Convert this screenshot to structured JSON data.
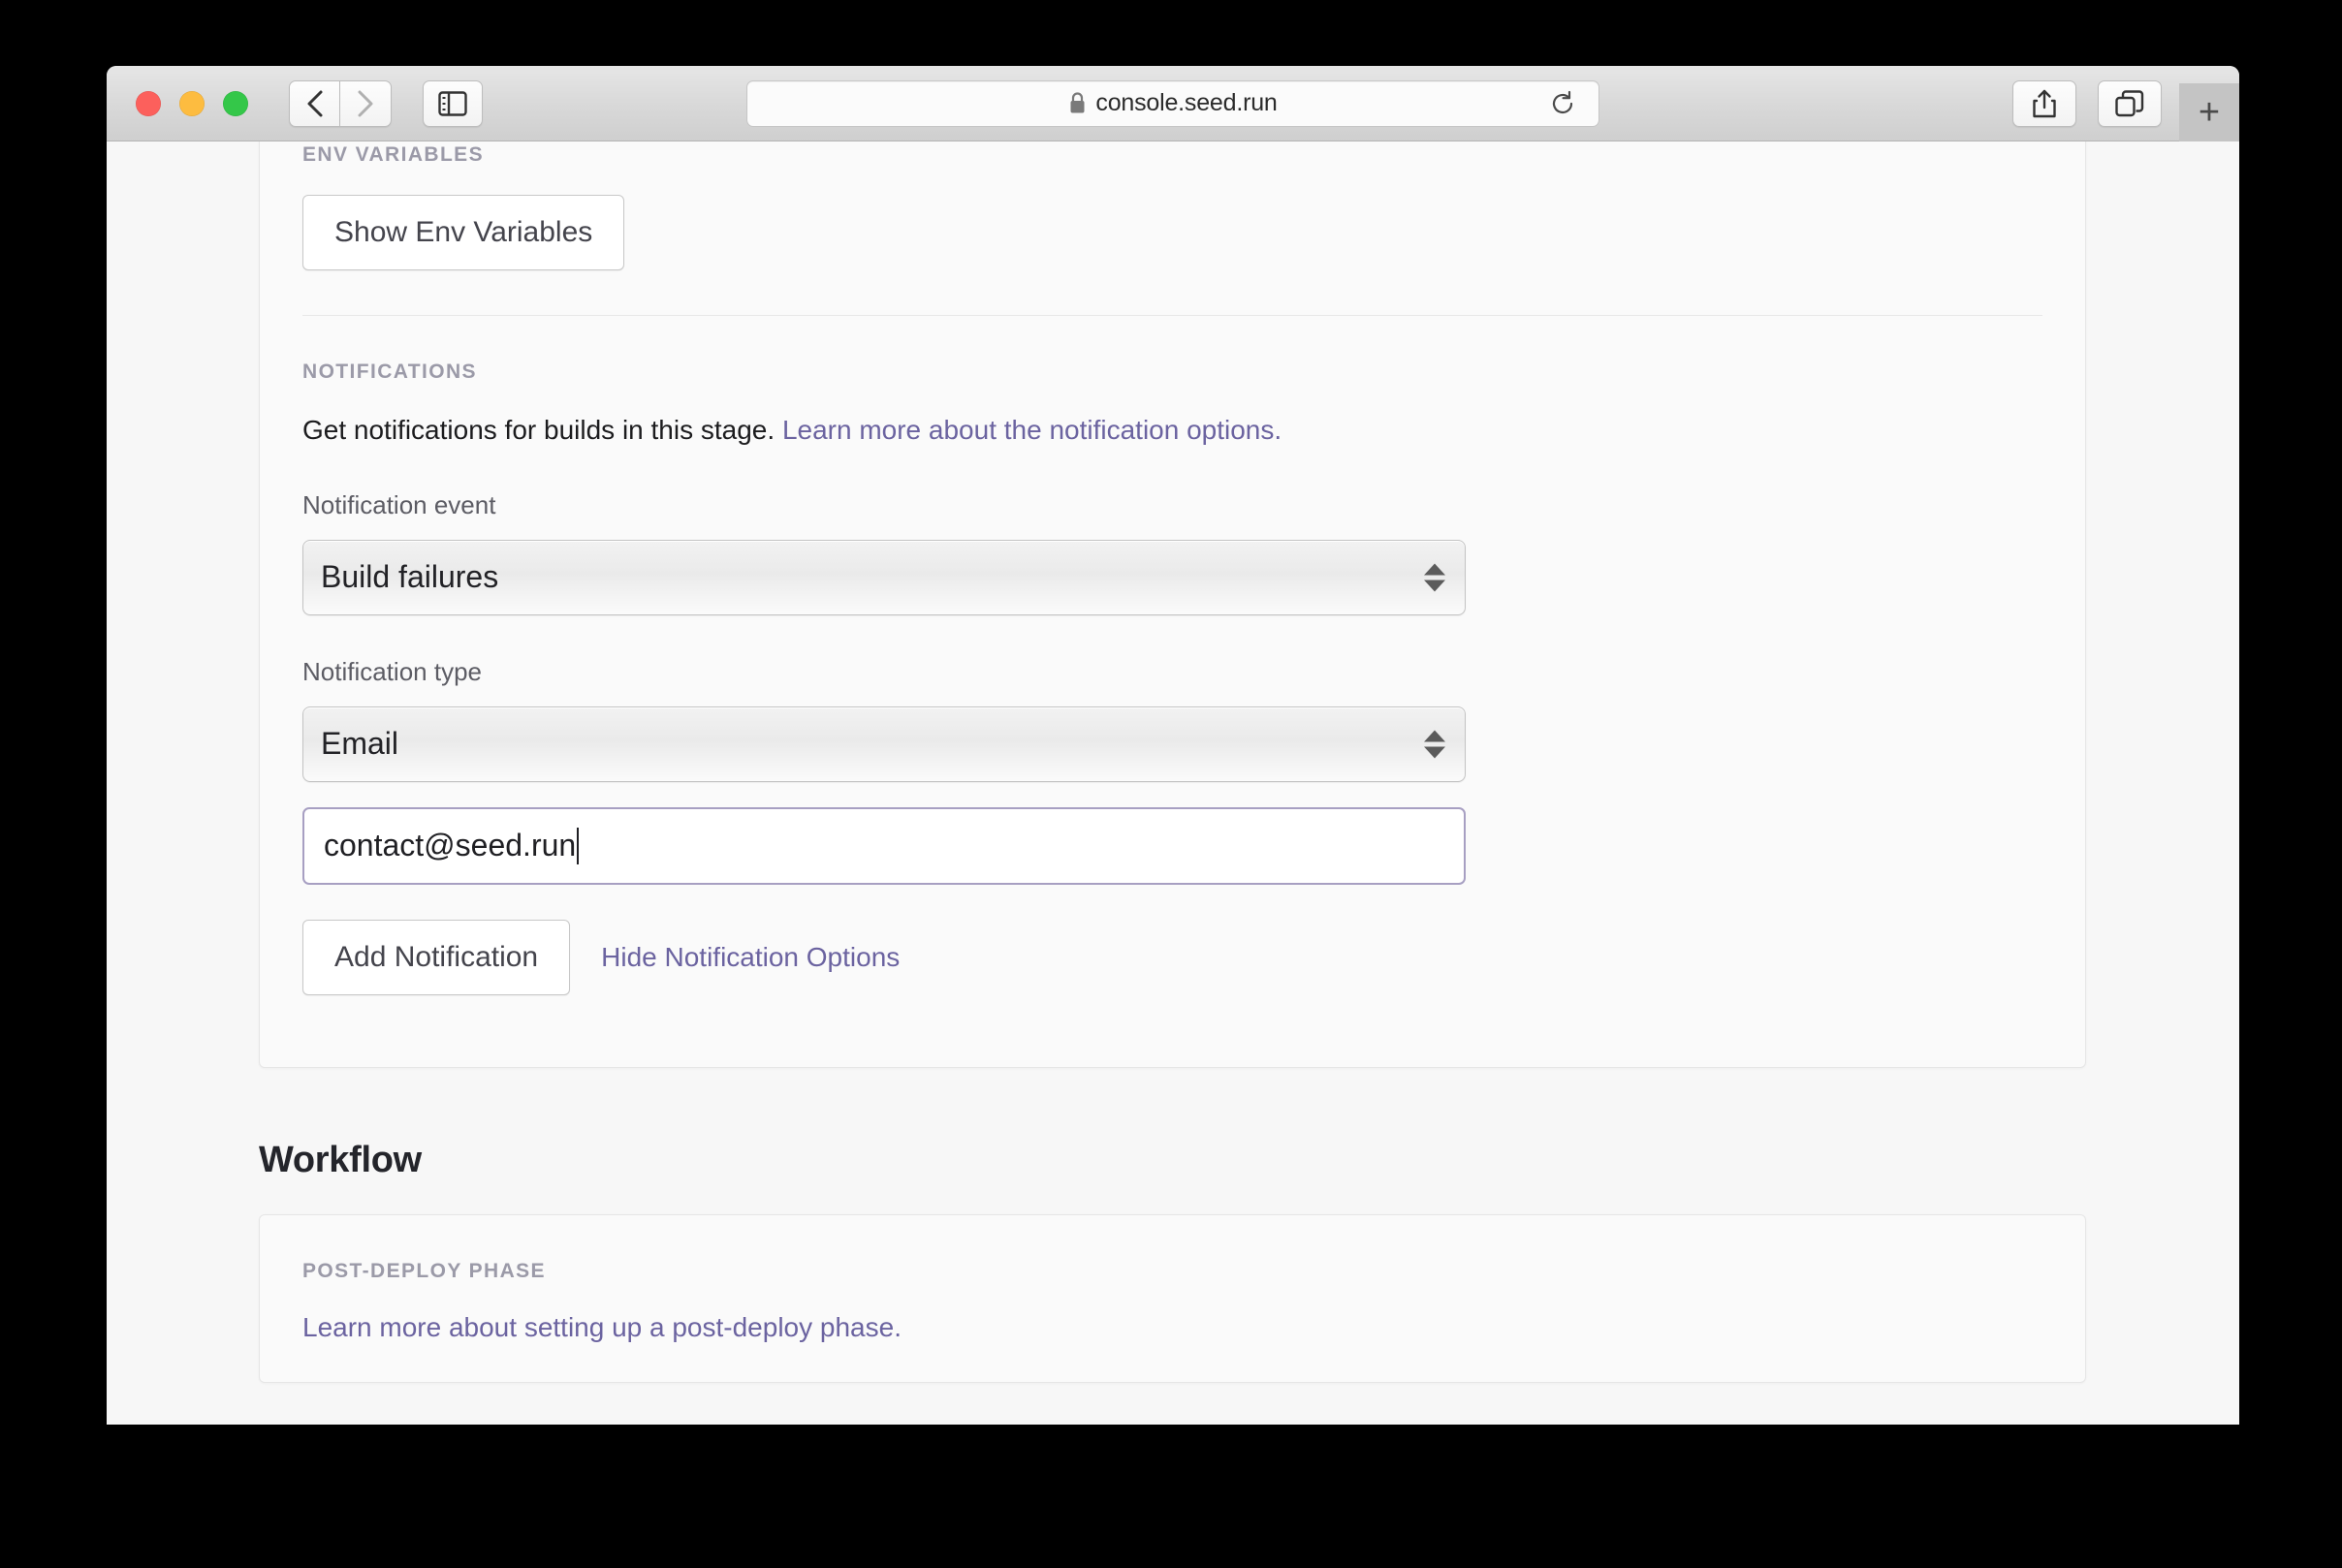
{
  "browser": {
    "url": "console.seed.run",
    "lock_icon": "lock-icon",
    "reload_icon": "reload-icon",
    "back_icon": "chevron-left-icon",
    "forward_icon": "chevron-right-icon",
    "sidebar_icon": "sidebar-toggle-icon",
    "share_icon": "share-icon",
    "tab_overview_icon": "tab-overview-icon",
    "new_tab_label": "+"
  },
  "settings": {
    "env_variables": {
      "section_label": "ENV VARIABLES",
      "show_button_label": "Show Env Variables"
    },
    "notifications": {
      "section_label": "NOTIFICATIONS",
      "description": "Get notifications for builds in this stage.",
      "description_link": "Learn more about the notification options.",
      "event_label": "Notification event",
      "event_value": "Build failures",
      "type_label": "Notification type",
      "type_value": "Email",
      "email_value": "contact@seed.run",
      "add_button_label": "Add Notification",
      "hide_options_link": "Hide Notification Options"
    }
  },
  "workflow": {
    "heading": "Workflow",
    "post_deploy": {
      "section_label": "POST-DEPLOY PHASE",
      "link": "Learn more about setting up a post-deploy phase."
    }
  },
  "colors": {
    "link_purple": "#6b63a0",
    "focus_border": "#a79fc2",
    "section_label_gray": "#9b9aa8",
    "page_background": "#f7f7f7"
  }
}
